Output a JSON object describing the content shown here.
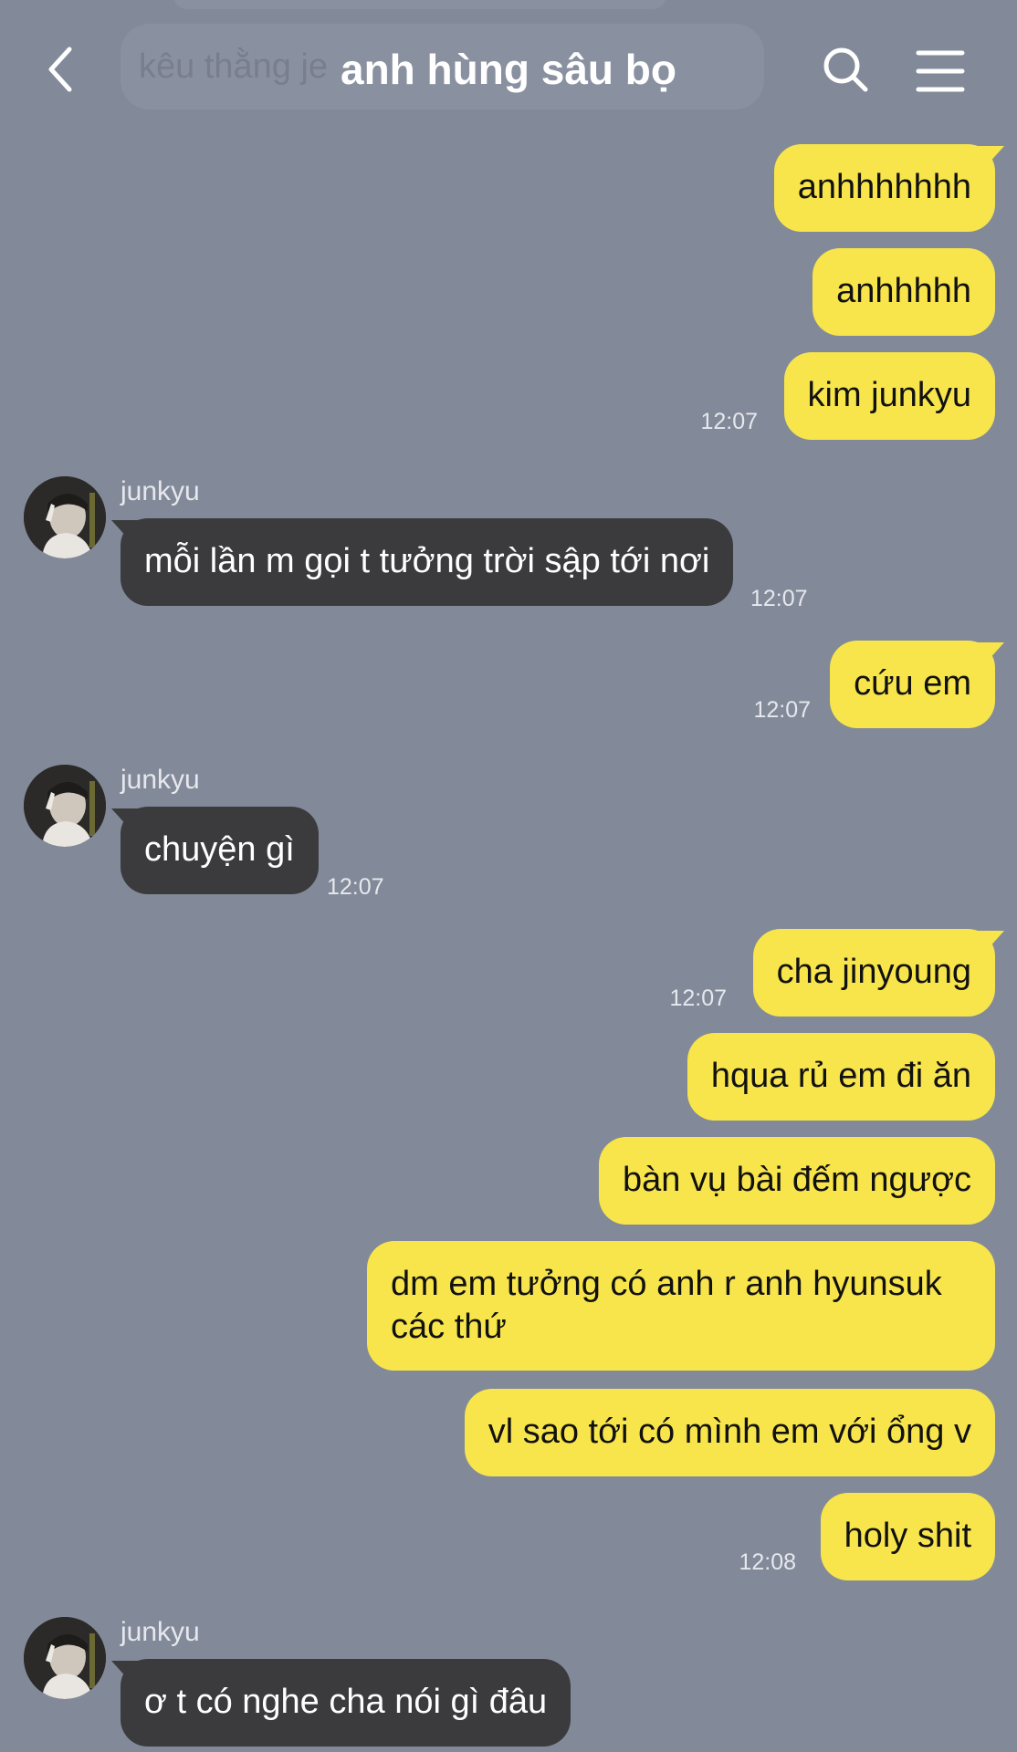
{
  "header": {
    "title": "anh hùng sâu bọ",
    "ghost_preview": "kêu thằng je",
    "ghost_time": ""
  },
  "messages": {
    "m1": "anhhhhhhh",
    "m2": "anhhhhh",
    "m3": "kim junkyu",
    "m3_time": "12:07",
    "m4_sender": "junkyu",
    "m4": "mỗi lần m gọi t tưởng trời sập tới nơi",
    "m4_time": "12:07",
    "m5": "cứu em",
    "m5_time": "12:07",
    "m6_sender": "junkyu",
    "m6": "chuyện gì",
    "m6_time": "12:07",
    "m7": "cha jinyoung",
    "m7_time": "12:07",
    "m8": "hqua rủ em đi ăn",
    "m9": "bàn vụ bài đếm ngược",
    "m10": "dm em tưởng có anh r anh hyunsuk các thứ",
    "m11": "vl sao tới có mình em với ổng v",
    "m12": "holy shit",
    "m12_time": "12:08",
    "m13_sender": "junkyu",
    "m13": "ơ t có nghe cha nói gì đâu"
  },
  "colors": {
    "background": "#828a99",
    "sent_bubble": "#f8e54b",
    "received_bubble": "#3b3b3e"
  },
  "icons": {
    "back": "chevron-left-icon",
    "search": "search-icon",
    "menu": "hamburger-menu-icon"
  }
}
